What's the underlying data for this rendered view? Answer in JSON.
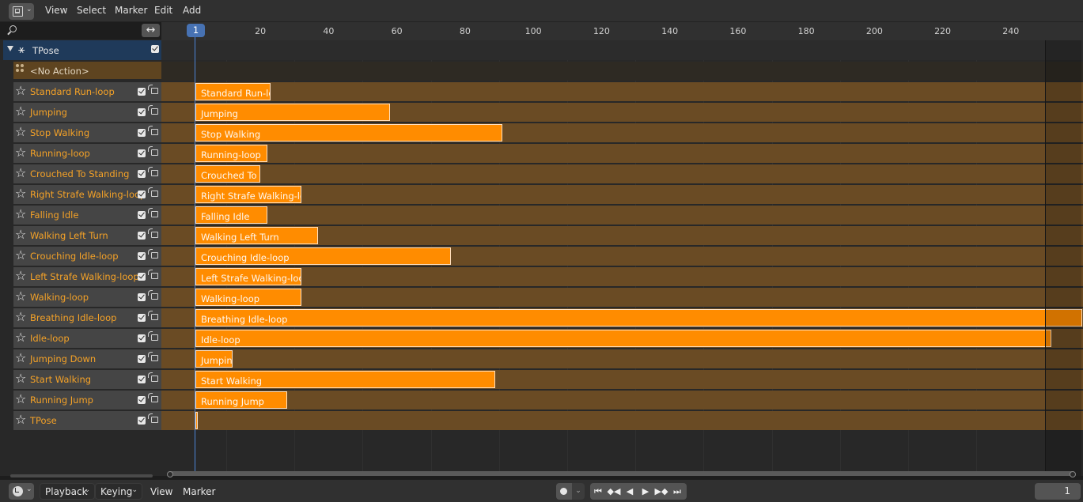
{
  "header": {
    "editor_type_icon": "nla-editor-icon",
    "menus": [
      "View",
      "Select",
      "Marker",
      "Edit",
      "Add"
    ]
  },
  "channels": {
    "search": {
      "value": "",
      "placeholder": ""
    },
    "swap_icon": "↔",
    "object": {
      "name": "TPose",
      "icon": "armature-icon",
      "checked": true
    },
    "no_action_label": "<No Action>",
    "tracks": [
      {
        "name": "Standard Run-loop",
        "strip": "Standard Run-lo",
        "start": 1,
        "end": 23
      },
      {
        "name": "Jumping",
        "strip": "Jumping",
        "start": 1,
        "end": 58
      },
      {
        "name": "Stop Walking",
        "strip": "Stop Walking",
        "start": 1,
        "end": 91
      },
      {
        "name": "Running-loop",
        "strip": "Running-loop",
        "start": 1,
        "end": 22
      },
      {
        "name": "Crouched To Standing",
        "strip": "Crouched To",
        "start": 1,
        "end": 20
      },
      {
        "name": "Right Strafe Walking-loop",
        "strip": "Right Strafe Walking-loo",
        "start": 1,
        "end": 32
      },
      {
        "name": "Falling Idle",
        "strip": "Falling Idle",
        "start": 1,
        "end": 22
      },
      {
        "name": "Walking Left Turn",
        "strip": "Walking Left Turn",
        "start": 1,
        "end": 37
      },
      {
        "name": "Crouching Idle-loop",
        "strip": "Crouching Idle-loop",
        "start": 1,
        "end": 76
      },
      {
        "name": "Left Strafe Walking-loop",
        "strip": "Left Strafe Walking-loop",
        "start": 1,
        "end": 32
      },
      {
        "name": "Walking-loop",
        "strip": "Walking-loop",
        "start": 1,
        "end": 32
      },
      {
        "name": "Breathing Idle-loop",
        "strip": "Breathing Idle-loop",
        "start": 1,
        "end": 261
      },
      {
        "name": "Idle-loop",
        "strip": "Idle-loop",
        "start": 1,
        "end": 252
      },
      {
        "name": "Jumping Down",
        "strip": "Jumpin",
        "start": 1,
        "end": 12
      },
      {
        "name": "Start Walking",
        "strip": "Start Walking",
        "start": 1,
        "end": 89
      },
      {
        "name": "Running Jump",
        "strip": "Running Jump",
        "start": 1,
        "end": 28
      },
      {
        "name": "TPose",
        "strip": "",
        "start": 1,
        "end": 1.5
      }
    ]
  },
  "timeline": {
    "current_frame": "1",
    "ticks": [
      "20",
      "40",
      "60",
      "80",
      "100",
      "120",
      "140",
      "160",
      "180",
      "200",
      "220",
      "240"
    ],
    "frame_range_end": 250
  },
  "footer": {
    "editor_type_icon": "clock-icon",
    "playback_label": "Playback",
    "keying_label": "Keying",
    "view_label": "View",
    "marker_label": "Marker",
    "record_icon": "record-icon",
    "transport": [
      "⏮",
      "◆◀",
      "◀",
      "▶",
      "▶◆",
      "⏭"
    ],
    "current_frame": "1"
  },
  "colors": {
    "strip": "#ff8c00",
    "track_name": "#f5a227",
    "playhead": "#4d86d8",
    "object_row": "#1f3a5a"
  }
}
